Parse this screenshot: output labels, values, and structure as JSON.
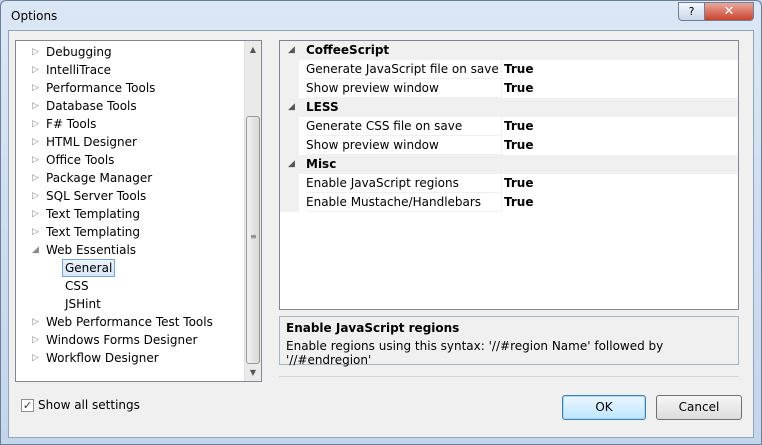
{
  "window": {
    "title": "Options",
    "help_label": "?",
    "close_label": "✕"
  },
  "tree": {
    "items": [
      {
        "label": "Debugging",
        "arrow": "▷",
        "level": 0
      },
      {
        "label": "IntelliTrace",
        "arrow": "▷",
        "level": 0
      },
      {
        "label": "Performance Tools",
        "arrow": "▷",
        "level": 0
      },
      {
        "label": "Database Tools",
        "arrow": "▷",
        "level": 0
      },
      {
        "label": "F# Tools",
        "arrow": "▷",
        "level": 0
      },
      {
        "label": "HTML Designer",
        "arrow": "▷",
        "level": 0
      },
      {
        "label": "Office Tools",
        "arrow": "▷",
        "level": 0
      },
      {
        "label": "Package Manager",
        "arrow": "▷",
        "level": 0
      },
      {
        "label": "SQL Server Tools",
        "arrow": "▷",
        "level": 0
      },
      {
        "label": "Text Templating",
        "arrow": "▷",
        "level": 0
      },
      {
        "label": "Text Templating",
        "arrow": "▷",
        "level": 0
      },
      {
        "label": "Web Essentials",
        "arrow": "◢",
        "level": 0
      },
      {
        "label": "General",
        "arrow": "",
        "level": 1,
        "selected": true
      },
      {
        "label": "CSS",
        "arrow": "",
        "level": 1
      },
      {
        "label": "JSHint",
        "arrow": "",
        "level": 1
      },
      {
        "label": "Web Performance Test Tools",
        "arrow": "▷",
        "level": 0
      },
      {
        "label": "Windows Forms Designer",
        "arrow": "▷",
        "level": 0
      },
      {
        "label": "Workflow Designer",
        "arrow": "▷",
        "level": 0
      }
    ],
    "scroll_up": "▲",
    "scroll_down": "▼",
    "scroll_grip": "≡"
  },
  "grid": {
    "categories": [
      {
        "name": "CoffeeScript",
        "arrow": "◢",
        "props": [
          {
            "name": "Generate JavaScript file on save",
            "value": "True"
          },
          {
            "name": "Show preview window",
            "value": "True"
          }
        ]
      },
      {
        "name": "LESS",
        "arrow": "◢",
        "props": [
          {
            "name": "Generate CSS file on save",
            "value": "True"
          },
          {
            "name": "Show preview window",
            "value": "True"
          }
        ]
      },
      {
        "name": "Misc",
        "arrow": "◢",
        "props": [
          {
            "name": "Enable JavaScript regions",
            "value": "True"
          },
          {
            "name": "Enable Mustache/Handlebars",
            "value": "True"
          }
        ]
      }
    ]
  },
  "description": {
    "title": "Enable JavaScript regions",
    "text": "Enable regions using this syntax: '//#region Name' followed by '//#endregion'"
  },
  "footer": {
    "show_all_label": "Show all settings",
    "show_all_checked": true,
    "check_mark": "✓",
    "ok_label": "OK",
    "cancel_label": "Cancel"
  }
}
